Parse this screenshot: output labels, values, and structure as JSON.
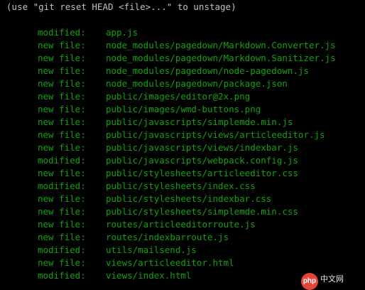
{
  "hint_line": "(use \"git reset HEAD <file>...\" to unstage)",
  "entries": [
    {
      "status": "modified:",
      "path": "app.js"
    },
    {
      "status": "new file:",
      "path": "node_modules/pagedown/Markdown.Converter.js"
    },
    {
      "status": "new file:",
      "path": "node_modules/pagedown/Markdown.Sanitizer.js"
    },
    {
      "status": "new file:",
      "path": "node_modules/pagedown/node-pagedown.js"
    },
    {
      "status": "new file:",
      "path": "node_modules/pagedown/package.json"
    },
    {
      "status": "new file:",
      "path": "public/images/editor@2x.png"
    },
    {
      "status": "new file:",
      "path": "public/images/wmd-buttons.png"
    },
    {
      "status": "new file:",
      "path": "public/javascripts/simplemde.min.js"
    },
    {
      "status": "new file:",
      "path": "public/javascripts/views/articleeditor.js"
    },
    {
      "status": "new file:",
      "path": "public/javascripts/views/indexbar.js"
    },
    {
      "status": "modified:",
      "path": "public/javascripts/webpack.config.js"
    },
    {
      "status": "new file:",
      "path": "public/stylesheets/articleeditor.css"
    },
    {
      "status": "modified:",
      "path": "public/stylesheets/index.css"
    },
    {
      "status": "new file:",
      "path": "public/stylesheets/indexbar.css"
    },
    {
      "status": "new file:",
      "path": "public/stylesheets/simplemde.min.css"
    },
    {
      "status": "new file:",
      "path": "routes/articleeditorroute.js"
    },
    {
      "status": "new file:",
      "path": "routes/indexbarroute.js"
    },
    {
      "status": "modified:",
      "path": "utils/mailsend.js"
    },
    {
      "status": "new file:",
      "path": "views/articleeditor.html"
    },
    {
      "status": "modified:",
      "path": "views/index.html"
    }
  ],
  "watermark": {
    "logo_text": "php",
    "site_text": "中文网"
  },
  "colors": {
    "background": "#000000",
    "staged_text": "#13a10e",
    "hint_text": "#c0c0c0",
    "watermark_logo": "#e2463b"
  }
}
